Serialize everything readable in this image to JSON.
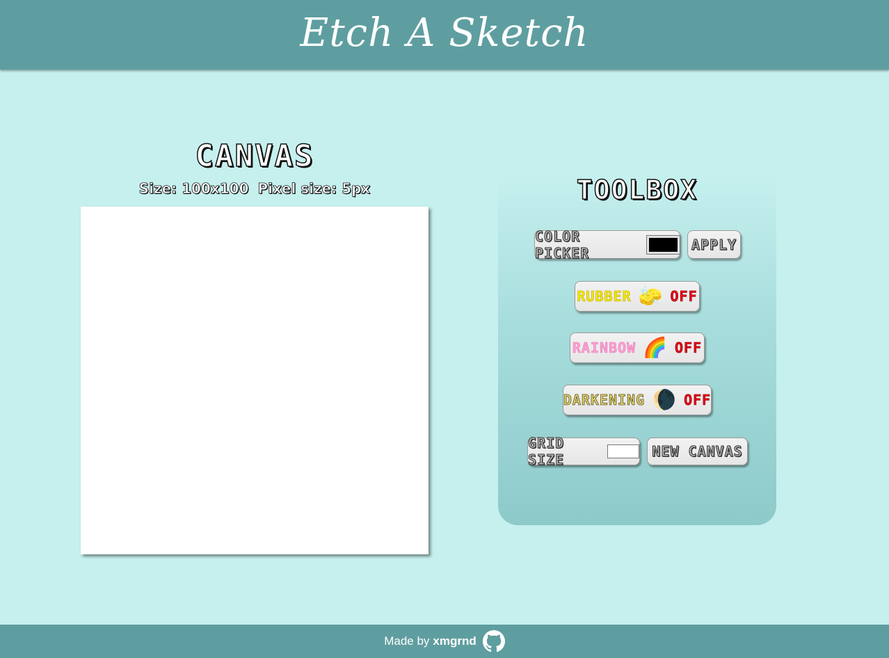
{
  "header": {
    "title": "Etch A Sketch"
  },
  "canvas": {
    "title": "CANVAS",
    "size_text": "Size: 100x100",
    "pixel_size_text": "Pixel size: 5px"
  },
  "toolbox": {
    "title": "TOOLBOX",
    "color_picker": {
      "label": "COLOR PICKER",
      "value": "#000000"
    },
    "apply_label": "APPLY",
    "rubber": {
      "label": "RUBBER",
      "emoji": "🧽",
      "state": "OFF"
    },
    "rainbow": {
      "label": "RAINBOW",
      "emoji": "🌈",
      "state": "OFF"
    },
    "darkening": {
      "label": "DARKENING",
      "emoji": "🌘",
      "state": "OFF"
    },
    "grid_size": {
      "label": "GRID SIZE",
      "value": ""
    },
    "new_canvas_label": "NEW CANVAS"
  },
  "footer": {
    "made_by": "Made by",
    "author": "xmgrnd",
    "icon": "github-icon"
  }
}
